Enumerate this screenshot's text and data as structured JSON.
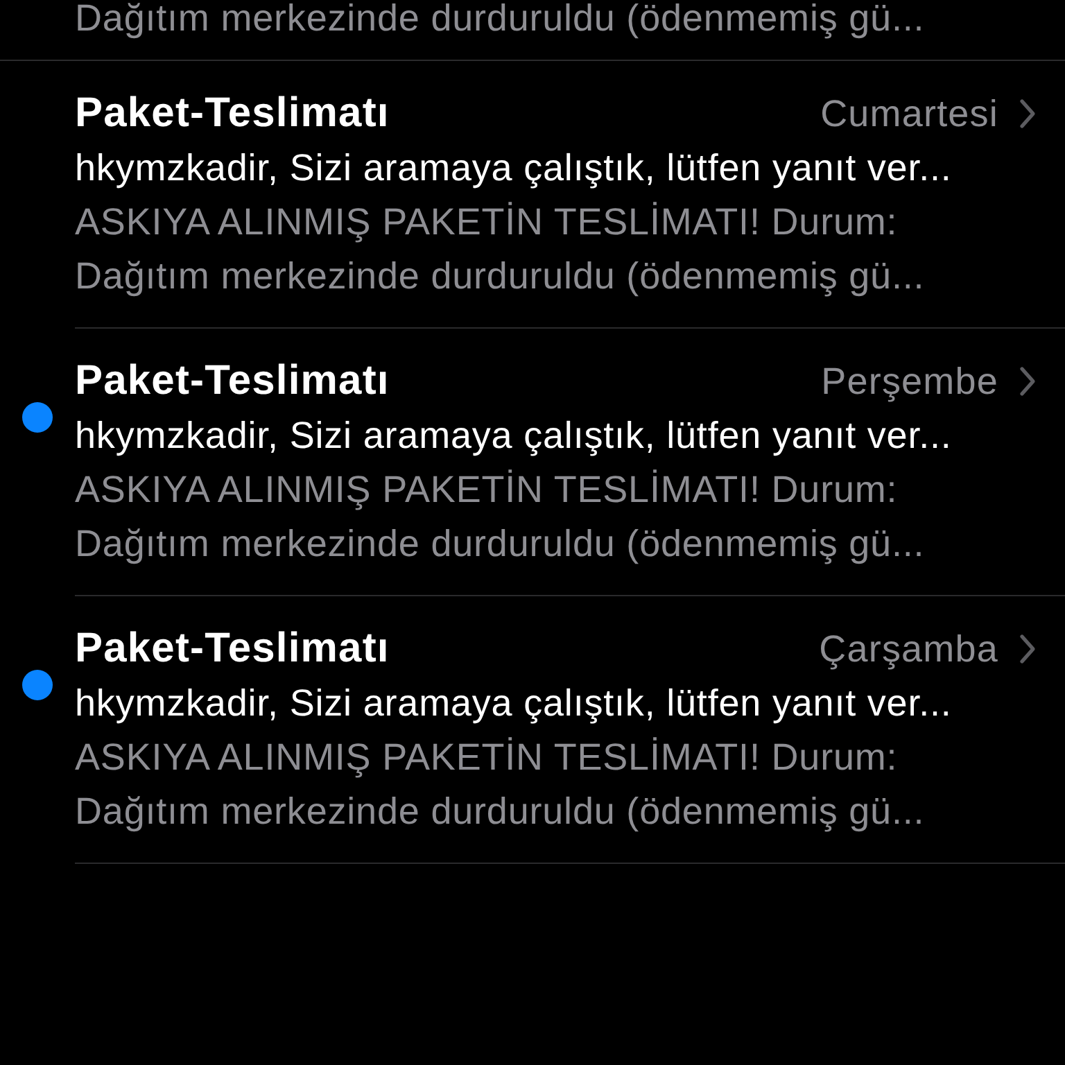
{
  "partial_preview": "Dağıtım merkezinde durduruldu (ödenmemiş gü...",
  "messages": [
    {
      "sender": "Paket-Teslimatı",
      "date": "Cumartesi",
      "unread": false,
      "subject": "hkymzkadir, Sizi aramaya çalıştık, lütfen yanıt ver...",
      "preview_lines": [
        "ASKIYA ALINMIŞ PAKETİN TESLİMATI! Durum:",
        "Dağıtım merkezinde durduruldu (ödenmemiş gü..."
      ]
    },
    {
      "sender": "Paket-Teslimatı",
      "date": "Perşembe",
      "unread": true,
      "subject": "hkymzkadir, Sizi aramaya çalıştık, lütfen yanıt ver...",
      "preview_lines": [
        "ASKIYA ALINMIŞ PAKETİN TESLİMATI! Durum:",
        "Dağıtım merkezinde durduruldu (ödenmemiş gü..."
      ]
    },
    {
      "sender": "Paket-Teslimatı",
      "date": "Çarşamba",
      "unread": true,
      "subject": "hkymzkadir, Sizi aramaya çalıştık, lütfen yanıt ver...",
      "preview_lines": [
        "ASKIYA ALINMIŞ PAKETİN TESLİMATI! Durum:",
        "Dağıtım merkezinde durduruldu (ödenmemiş gü..."
      ]
    }
  ]
}
